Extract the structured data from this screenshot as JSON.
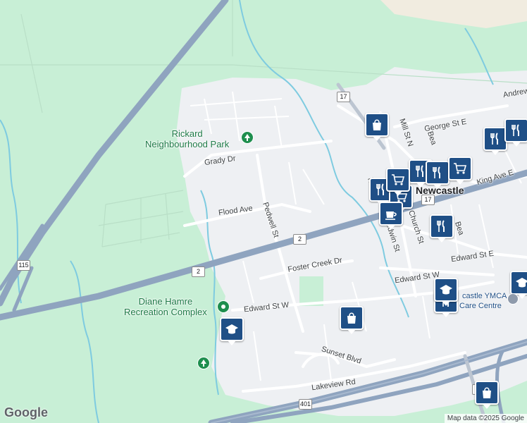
{
  "map": {
    "parks": [
      {
        "name": "Rickard Neighbourhood Park",
        "line1": "Rickard",
        "line2": "Neighbourhood Park"
      },
      {
        "name": "Diane Hamre Recreation Complex",
        "line1": "Diane Hamre",
        "line2": "Recreation Complex"
      }
    ],
    "town": "Newcastle",
    "streets": {
      "grady": "Grady Dr",
      "flood": "Flood Ave",
      "pedwell": "Pedwell St",
      "foster": "Foster Creek Dr",
      "edward_w": "Edward St W",
      "edward_w2": "Edward St W",
      "edward_e": "Edward St E",
      "sunset": "Sunset Blvd",
      "lakeview": "Lakeview Rd",
      "george": "George St E",
      "andrew": "Andrew",
      "mill": "Mill St N",
      "king": "King Ave E",
      "baldwin": "Baldwin St",
      "church": "Church St",
      "beaver_n": "Bea",
      "beaver_s": "Bea",
      "n_prefix": "N"
    },
    "place_labels": {
      "ymca_1": "castle YMCA",
      "ymca_2": "Care Centre"
    },
    "route_shields": {
      "r115": "115",
      "r2a": "2",
      "r2b": "2",
      "r17a": "17",
      "r17b": "17",
      "r17c": "17",
      "r401": "401"
    },
    "markers": [
      {
        "type": "shopping-bag-icon"
      },
      {
        "type": "restaurant-icon"
      },
      {
        "type": "grocery-cart-icon"
      },
      {
        "type": "cafe-icon"
      },
      {
        "type": "school-icon"
      }
    ],
    "logo": "Google",
    "credit": "Map data ©2025 Google",
    "colors": {
      "green_space": "#c8efd6",
      "urban": "#eef0f3",
      "highway": "#8fa4bf",
      "water": "#7ecbe0",
      "marker": "#1f4f86"
    }
  }
}
